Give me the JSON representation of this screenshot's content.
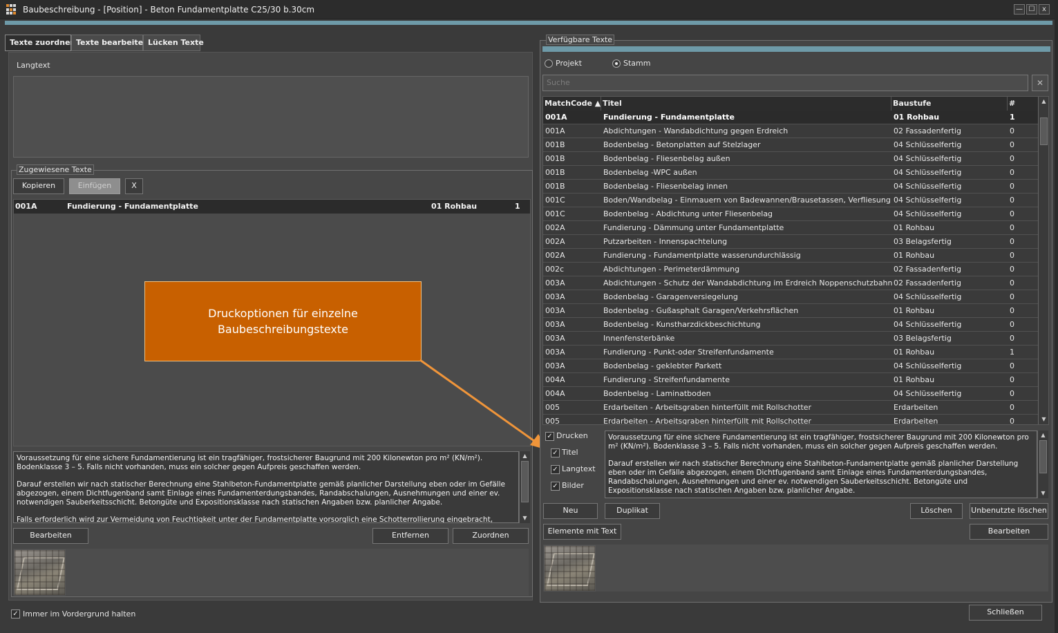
{
  "window": {
    "title": "Baubeschreibung - [Position] - Beton Fundamentplatte C25/30 b.30cm",
    "min_label": "—",
    "max_label": "☐",
    "close_label": "x"
  },
  "tabs": [
    "Texte zuordnen",
    "Texte bearbeiten",
    "Lücken Texte"
  ],
  "left": {
    "langtext_label": "Langtext",
    "assigned_group_label": "Zugewiesene Texte",
    "toolbar": {
      "copy": "Kopieren",
      "insert": "Einfügen",
      "remove_x": "X"
    },
    "assigned_rows": [
      {
        "code": "001A",
        "title": "Fundierung - Fundamentplatte",
        "stage": "01 Rohbau",
        "count": "1"
      }
    ],
    "detail_text": [
      "Voraussetzung für eine sichere Fundamentierung ist ein tragfähiger, frostsicherer Baugrund mit 200 Kilonewton pro m² (KN/m²). Bodenklasse 3 – 5. Falls nicht vorhanden, muss ein solcher gegen Aufpreis geschaffen werden.",
      "Darauf erstellen wir nach statischer Berechnung eine Stahlbeton-Fundamentplatte gemäß planlicher Darstellung eben oder im Gefälle abgezogen, einem Dichtfugenband samt Einlage eines Fundamenterdungsbandes, Randabschalungen, Ausnehmungen und einer ev. notwendigen Sauberkeitsschicht. Betongüte und Expositionsklasse nach statischen Angaben bzw. planlicher Angabe.",
      "Falls erforderlich wird zur Vermeidung von Feuchtigkeit unter der Fundamentplatte vorsorglich eine Schotterrollierung eingebracht, welche"
    ],
    "buttons": {
      "edit": "Bearbeiten",
      "remove": "Entfernen",
      "assign": "Zuordnen"
    },
    "always_on_top": "Immer im Vordergrund halten"
  },
  "callout": {
    "line1": "Druckoptionen für einzelne",
    "line2": "Baubeschreibungstexte"
  },
  "right": {
    "group_label": "Verfügbare Texte",
    "radio_project": "Projekt",
    "radio_master": "Stamm",
    "selected_radio": "Stamm",
    "search_placeholder": "Suche",
    "search_clear": "✕",
    "columns": {
      "code": "MatchCode ▲",
      "title": "Titel",
      "stage": "Baustufe",
      "count": "#"
    },
    "rows": [
      {
        "code": "001A",
        "title": "Fundierung - Fundamentplatte",
        "stage": "01 Rohbau",
        "count": "1",
        "selected": true
      },
      {
        "code": "001A",
        "title": "Abdichtungen - Wandabdichtung gegen Erdreich",
        "stage": "02 Fassadenfertig",
        "count": "0"
      },
      {
        "code": "001B",
        "title": "Bodenbelag - Betonplatten auf Stelzlager",
        "stage": "04 Schlüsselfertig",
        "count": "0"
      },
      {
        "code": "001B",
        "title": "Bodenbelag - Fliesenbelag außen",
        "stage": "04 Schlüsselfertig",
        "count": "0"
      },
      {
        "code": "001B",
        "title": "Bodenbelag -WPC außen",
        "stage": "04 Schlüsselfertig",
        "count": "0"
      },
      {
        "code": "001B",
        "title": "Bodenbelag - Fliesenbelag innen",
        "stage": "04 Schlüsselfertig",
        "count": "0"
      },
      {
        "code": "001C",
        "title": "Boden/Wandbelag - Einmauern von Badewannen/Brausetassen, Verfliesung",
        "stage": "04 Schlüsselfertig",
        "count": "0"
      },
      {
        "code": "001C",
        "title": "Bodenbelag - Abdichtung unter Fliesenbelag",
        "stage": "04 Schlüsselfertig",
        "count": "0"
      },
      {
        "code": "002A",
        "title": "Fundierung - Dämmung unter Fundamentplatte",
        "stage": "01 Rohbau",
        "count": "0"
      },
      {
        "code": "002A",
        "title": "Putzarbeiten - Innenspachtelung",
        "stage": "03 Belagsfertig",
        "count": "0"
      },
      {
        "code": "002A",
        "title": "Fundierung - Fundamentplatte wasserundurchlässig",
        "stage": "01 Rohbau",
        "count": "0"
      },
      {
        "code": "002c",
        "title": "Abdichtungen - Perimeterdämmung",
        "stage": "02 Fassadenfertig",
        "count": "0"
      },
      {
        "code": "003A",
        "title": "Abdichtungen - Schutz der Wandabdichtung im Erdreich Noppenschutzbahn",
        "stage": "02 Fassadenfertig",
        "count": "0"
      },
      {
        "code": "003A",
        "title": "Bodenbelag - Garagenversiegelung",
        "stage": "04 Schlüsselfertig",
        "count": "0"
      },
      {
        "code": "003A",
        "title": "Bodenbelag - Gußasphalt Garagen/Verkehrsflächen",
        "stage": "01 Rohbau",
        "count": "0"
      },
      {
        "code": "003A",
        "title": "Bodenbelag - Kunstharzdickbeschichtung",
        "stage": "04 Schlüsselfertig",
        "count": "0"
      },
      {
        "code": "003A",
        "title": "Innenfensterbänke",
        "stage": "03 Belagsfertig",
        "count": "0"
      },
      {
        "code": "003A",
        "title": "Fundierung - Punkt-oder Streifenfundamente",
        "stage": "01 Rohbau",
        "count": "1"
      },
      {
        "code": "003A",
        "title": "Bodenbelag - geklebter Parkett",
        "stage": "04 Schlüsselfertig",
        "count": "0"
      },
      {
        "code": "004A",
        "title": "Fundierung - Streifenfundamente",
        "stage": "01 Rohbau",
        "count": "0"
      },
      {
        "code": "004A",
        "title": "Bodenbelag - Laminatboden",
        "stage": "04 Schlüsselfertig",
        "count": "0"
      },
      {
        "code": "005",
        "title": "Erdarbeiten - Arbeitsgraben hinterfüllt mit Rollschotter",
        "stage": "Erdarbeiten",
        "count": "0"
      },
      {
        "code": "005",
        "title": "Erdarbeiten - Arbeitsgraben hinterfüllt mit Rollschotter",
        "stage": "Erdarbeiten",
        "count": "0"
      }
    ],
    "print_options": {
      "print": "Drucken",
      "title": "Titel",
      "longtext": "Langtext",
      "images": "Bilder"
    },
    "detail_text": [
      "Voraussetzung für eine sichere Fundamentierung ist ein tragfähiger, frostsicherer Baugrund mit 200 Kilonewton pro m² (KN/m²). Bodenklasse 3 – 5. Falls nicht vorhanden, muss ein solcher gegen Aufpreis geschaffen werden.",
      "Darauf erstellen wir nach statischer Berechnung eine Stahlbeton-Fundamentplatte gemäß planlicher Darstellung eben oder im Gefälle abgezogen, einem Dichtfugenband samt Einlage eines Fundamenterdungsbandes, Randabschalungen, Ausnehmungen und einer ev. notwendigen Sauberkeitsschicht. Betongüte und Expositionsklasse nach statischen Angaben bzw. planlicher Angabe."
    ],
    "buttons": {
      "new": "Neu",
      "duplicate": "Duplikat",
      "delete": "Löschen",
      "delete_unused": "Unbenutzte löschen",
      "elements_with_text": "Elemente mit Text",
      "edit": "Bearbeiten"
    }
  },
  "footer": {
    "close": "Schließen"
  },
  "colors": {
    "accent": "#6e9aa8",
    "callout": "#c86000",
    "arrow": "#f0953a"
  }
}
